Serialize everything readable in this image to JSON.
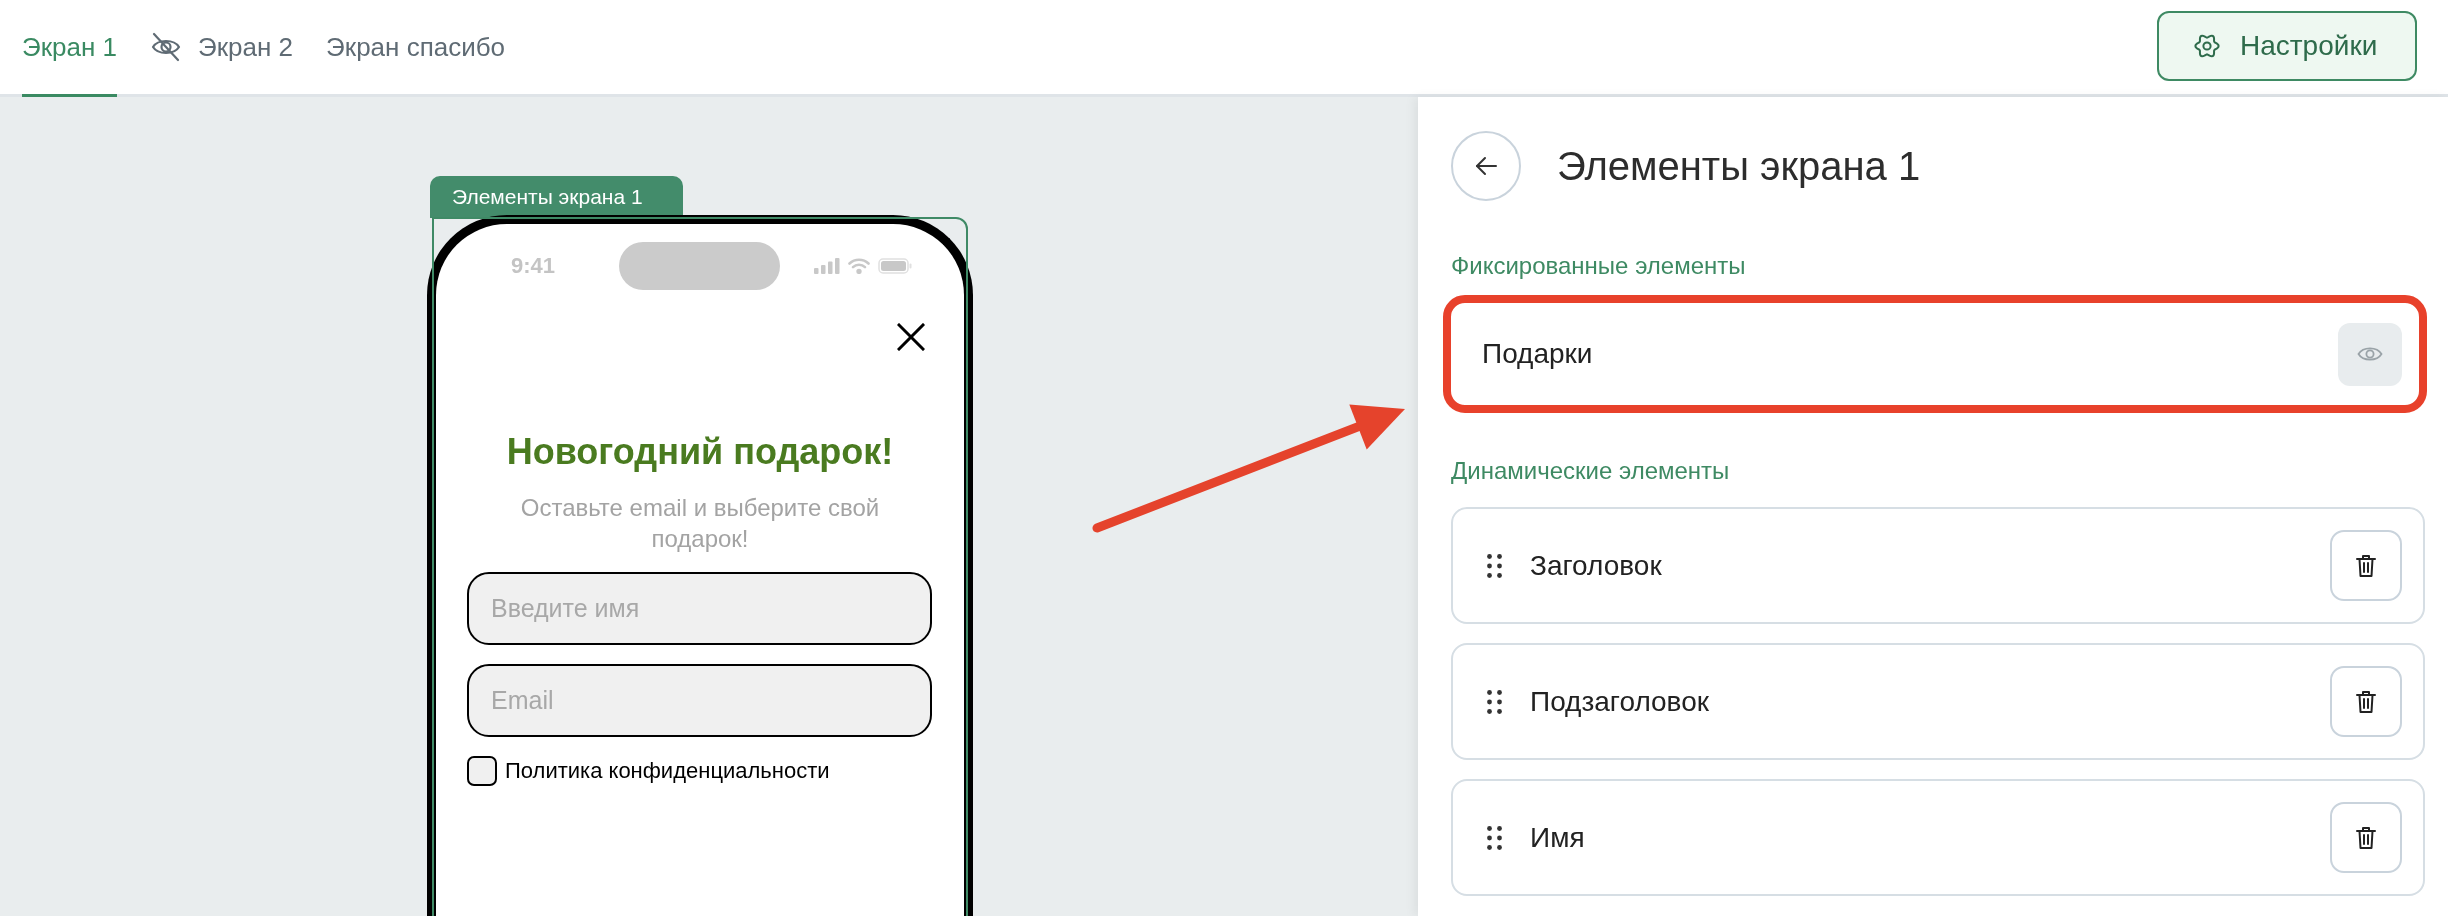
{
  "tabs": [
    {
      "label": "Экран 1",
      "selected": true,
      "hidden": false
    },
    {
      "label": "Экран 2",
      "selected": false,
      "hidden": true
    },
    {
      "label": "Экран спасибо",
      "selected": false,
      "hidden": false
    }
  ],
  "settings_button": {
    "label": "Настройки"
  },
  "canvas": {
    "frame_label": "Элементы экрана 1",
    "phone": {
      "status_time": "9:41",
      "title": "Новогодний подарок!",
      "subtitle": "Оставьте email и выберите свой подарок!",
      "fields": [
        {
          "placeholder": "Введите имя"
        },
        {
          "placeholder": "Email"
        }
      ],
      "consent": {
        "label": "Политика конфиденциальности",
        "checked": false
      }
    }
  },
  "panel": {
    "title": "Элементы экрана 1",
    "fixed_section": {
      "label": "Фиксированные элементы",
      "items": [
        {
          "label": "Подарки",
          "highlighted": true
        }
      ]
    },
    "dynamic_section": {
      "label": "Динамические элементы",
      "items": [
        {
          "label": "Заголовок"
        },
        {
          "label": "Подзаголовок"
        },
        {
          "label": "Имя"
        }
      ]
    }
  }
}
